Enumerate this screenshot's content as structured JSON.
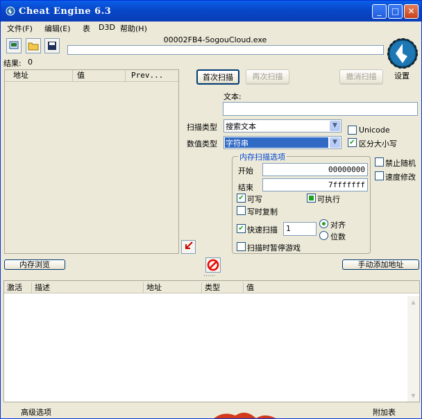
{
  "window": {
    "title": "Cheat Engine 6.3",
    "min": "_",
    "max": "□",
    "close": "✕"
  },
  "menu": [
    "文件(F)",
    "编辑(E)",
    "表",
    "D3D",
    "帮助(H)"
  ],
  "toolbar": {
    "open_process_icon": "process-icon",
    "open_icon": "folder-icon",
    "save_icon": "save-icon"
  },
  "process_name": "00002FB4-SogouCloud.exe",
  "results": {
    "label": "结果:",
    "count": "0"
  },
  "result_columns": [
    "地址",
    "值",
    "Prev..."
  ],
  "scan": {
    "first": "首次扫描",
    "next": "再次扫描",
    "undo": "撤消扫描",
    "settings": "设置"
  },
  "text_label": "文本:",
  "scan_type": {
    "label": "扫描类型",
    "value": "搜索文本"
  },
  "value_type": {
    "label": "数值类型",
    "value": "字符串"
  },
  "unicode": {
    "label": "Unicode",
    "checked": false
  },
  "case_sensitive": {
    "label": "区分大小写",
    "checked": true
  },
  "memory_options": {
    "title": "内存扫描选项",
    "start_label": "开始",
    "start": "00000000",
    "stop_label": "结束",
    "stop": "7fffffff",
    "writable": "可写",
    "executable": "可执行",
    "copy_on_write": "写时复制",
    "fast_scan": "快速扫描",
    "fast_value": "1",
    "align": "对齐",
    "last_digits": "位数",
    "pause": "扫描时暂停游戏"
  },
  "disable_random": "禁止随机",
  "speed_hack": "速度修改",
  "memory_view": "内存浏览",
  "add_address": "手动添加地址",
  "splitter": "......",
  "table_columns": [
    "激活",
    "描述",
    "地址",
    "类型",
    "值"
  ],
  "footer": {
    "advanced": "高级选项",
    "extras": "附加表"
  },
  "colors": {
    "title": "#0a5fe8",
    "selected": "#316ac5"
  }
}
